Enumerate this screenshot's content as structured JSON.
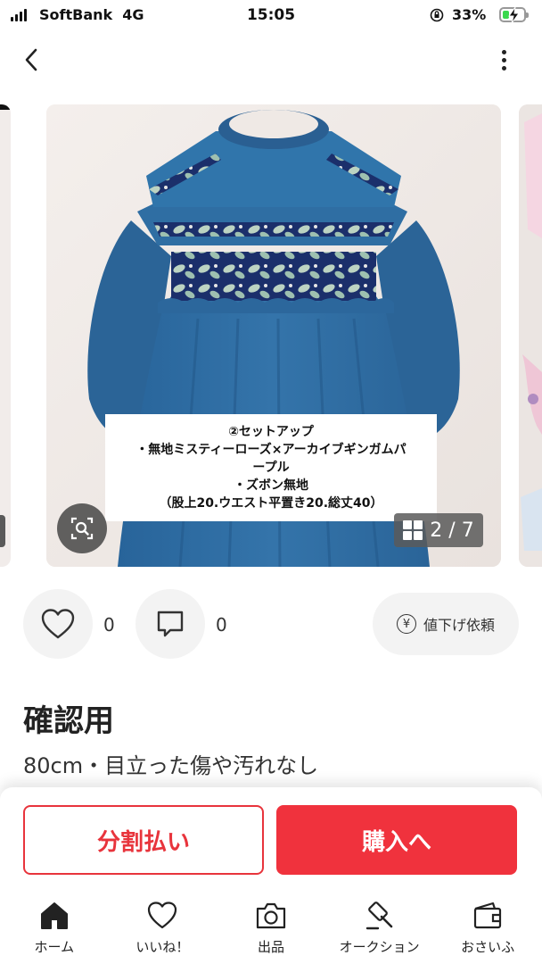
{
  "status_bar": {
    "carrier": "SoftBank",
    "network": "4G",
    "time": "15:05",
    "battery": "33%",
    "battery_level": 0.33
  },
  "nav": {
    "back_icon": "chevron-left-icon",
    "more_icon": "vertical-ellipsis-icon"
  },
  "gallery": {
    "caption_lines": [
      "②セットアップ",
      "・無地ミスティーローズ×アーカイブギンガムパ",
      "ープル",
      "・ズボン無地",
      "（股上20.ウエスト平置き20.総丈40）"
    ],
    "counter": "2 / 7",
    "zoom_icon": "image-search-icon",
    "grid_icon": "grid-icon"
  },
  "actions": {
    "like_count": "0",
    "comment_count": "0",
    "price_request_label": "値下げ依頼",
    "yen_symbol": "¥"
  },
  "item": {
    "title": "確認用",
    "subtitle": "80cm・目立った傷や汚れなし"
  },
  "buttons": {
    "installment": "分割払い",
    "purchase": "購入へ"
  },
  "tabs": [
    {
      "label": "ホーム",
      "icon": "home-icon"
    },
    {
      "label": "いいね！",
      "icon": "heart-icon"
    },
    {
      "label": "出品",
      "icon": "camera-icon"
    },
    {
      "label": "オークション",
      "icon": "gavel-icon"
    },
    {
      "label": "おさいふ",
      "icon": "wallet-icon"
    }
  ],
  "colors": {
    "accent_red": "#f0323d",
    "garment_blue": "#2f6ea3",
    "print_navy": "#1b2f6b"
  }
}
